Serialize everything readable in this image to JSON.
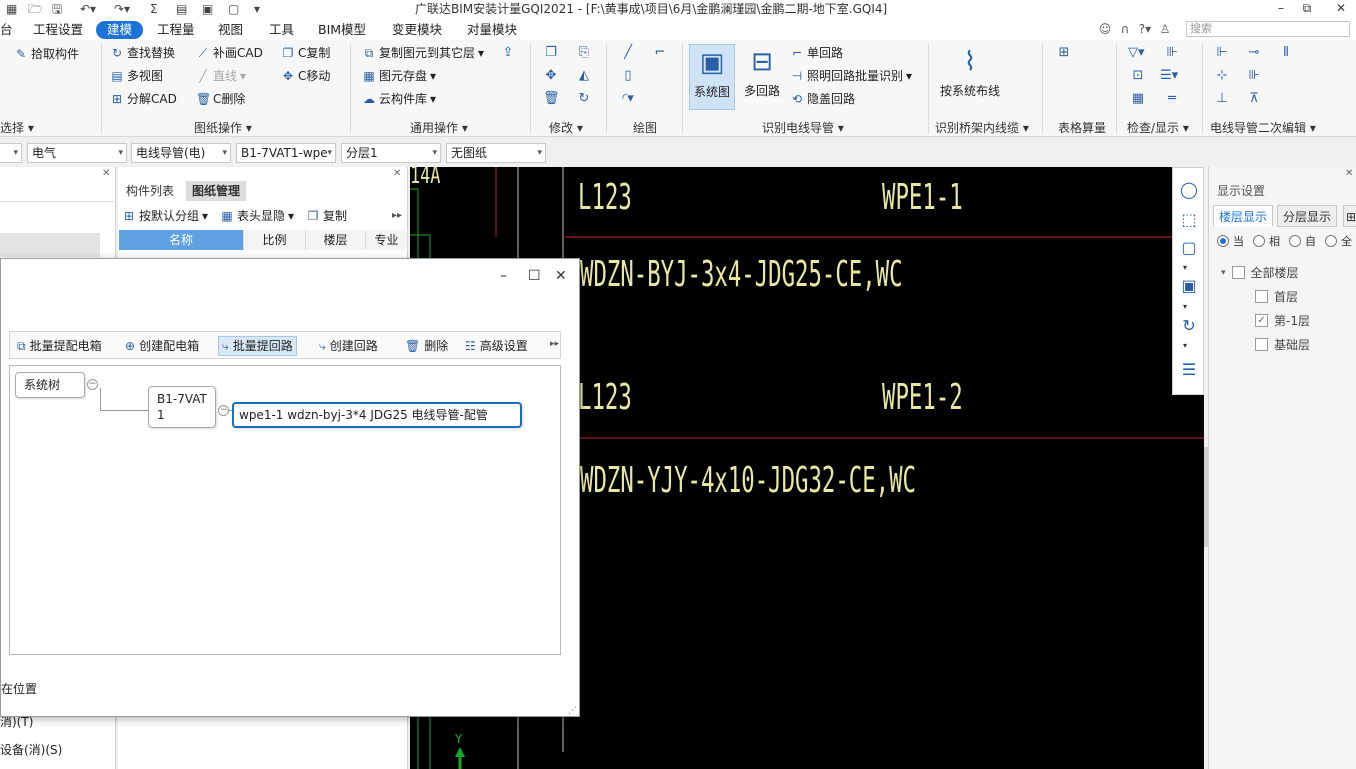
{
  "window": {
    "title": "广联达BIM安装计量GQI2021 - [F:\\黄事成\\项目\\6月\\金鹏澜瑾园\\金鹏二期-地下室.GQI4]",
    "minimize": "–",
    "restore": "⧉",
    "close": "✕"
  },
  "menu": {
    "items": [
      "台",
      "工程设置",
      "建模",
      "工程量",
      "视图",
      "工具",
      "BIM模型",
      "变更模块",
      "对量模块"
    ],
    "active_index": 2,
    "search_placeholder": "搜索"
  },
  "ribbon": {
    "pick_component": "拾取构件",
    "select_group": "选择",
    "find_replace": "查找替换",
    "multi_view": "多视图",
    "decompose_cad": "分解CAD",
    "redraw_cad": "补画CAD",
    "straight_line": "直线",
    "c_delete": "C删除",
    "c_copy": "C复制",
    "c_move": "C移动",
    "drawing_ops": "图纸操作",
    "copy_to_layer": "复制图元到其它层",
    "element_save": "图元存盘",
    "cloud_lib": "云构件库",
    "general_ops": "通用操作",
    "modify": "修改",
    "draw": "绘图",
    "system_diagram": "系统图",
    "multi_circuit": "多回路",
    "single_circuit": "单回路",
    "lighting_batch": "照明回路批量识别",
    "shielded_circuit": "隐盖回路",
    "identify_conduit": "识别电线导管",
    "by_system_wiring": "按系统布线",
    "identify_tray": "识别桥架内线缆",
    "table_calc": "表格算量",
    "check_display": "检查/显示",
    "conduit_edit2": "电线导管二次编辑"
  },
  "combos": [
    "",
    "电气",
    "电线导管(电)",
    "B1-7VAT1-wpe",
    "分层1",
    "无图纸"
  ],
  "mid_panel": {
    "tabs": [
      "构件列表",
      "图纸管理"
    ],
    "group_default": "按默认分组",
    "header_display": "表头显隐",
    "copy": "复制",
    "columns": [
      "名称",
      "比例",
      "楼层",
      "专业"
    ]
  },
  "dialog": {
    "toolbar": [
      "批量提配电箱",
      "创建配电箱",
      "批量提回路",
      "创建回路",
      "删除",
      "高级设置"
    ],
    "selected_tool_index": 2,
    "nodes": {
      "root": "系统树",
      "box": "B1-7VAT 1",
      "circuit": "wpe1-1 wdzn-byj-3*4 JDG25 电线导管-配管"
    },
    "footer_text": "在位置"
  },
  "left_bottom": [
    "消)(T)",
    "设备(消)(S)"
  ],
  "cad": {
    "top_label": "14A",
    "l1": "L123",
    "w1": "WPE1-1",
    "spec1": "WDZN-BYJ-3x4-JDG25-CE,WC",
    "l2": "L123",
    "w2": "WPE1-2",
    "spec2": "WDZN-YJY-4x10-JDG32-CE,WC",
    "axis_y": "Y"
  },
  "display_settings": {
    "title": "显示设置",
    "tabs": [
      "楼层显示",
      "分层显示"
    ],
    "radios": [
      "当",
      "相",
      "自",
      "全"
    ],
    "tree": {
      "all": "全部楼层",
      "first": "首层",
      "minus1": "第-1层",
      "base": "基础层"
    }
  },
  "colors": {
    "accent": "#1a73d9",
    "cad_text": "#e8e8a0",
    "cad_red": "#c0282a",
    "cad_green": "#17a82a"
  }
}
